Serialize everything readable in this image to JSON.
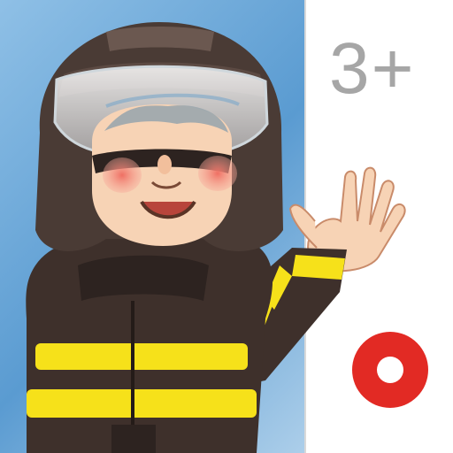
{
  "age_rating": "3+",
  "colors": {
    "sky_light": "#cfe4f4",
    "sky_dark": "#5a9bd1",
    "panel": "#ffffff",
    "age_text": "#a6a6a6",
    "helmet": "#4a3b35",
    "coat": "#3e302b",
    "reflective_stripe": "#f6e11a",
    "skin": "#f7d3b5",
    "cheek": "#ef6f63",
    "hair": "#9aa6ad",
    "logo_red": "#e22a24"
  },
  "icons": {
    "illustration": "firefighter-child-waving",
    "logo": "red-ring-logo"
  }
}
